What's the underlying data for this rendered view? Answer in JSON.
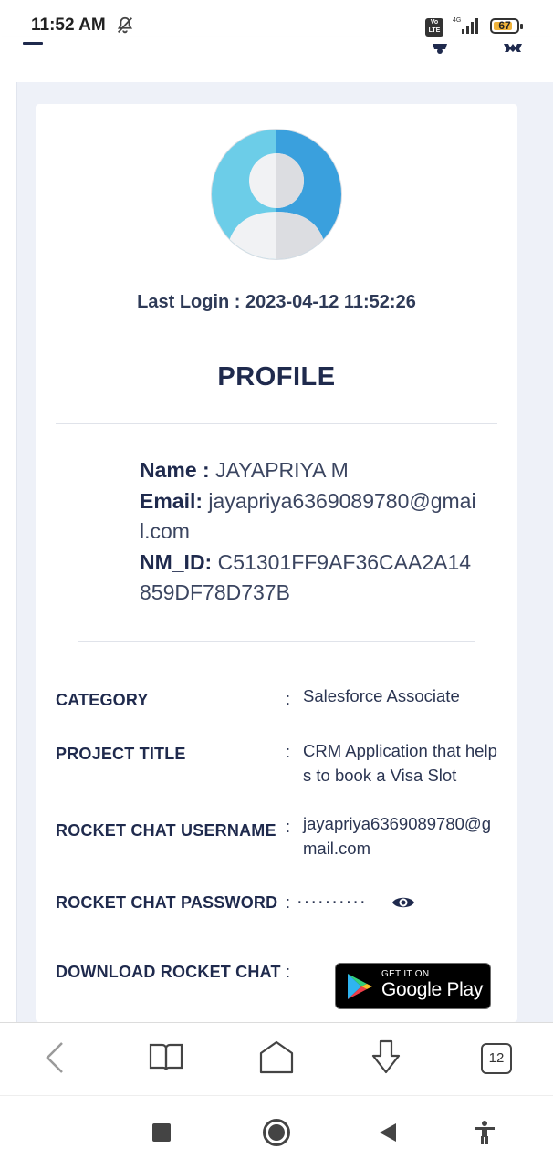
{
  "status_bar": {
    "time": "11:52 AM",
    "network_label": "4G",
    "volte_label": "Vo LTE",
    "battery_level": "67",
    "colors": {
      "battery_fill": "#f0b33a"
    }
  },
  "header": {
    "icons": [
      "menu-icon",
      "bell-icon",
      "gear-icon"
    ]
  },
  "profile": {
    "last_login": "Last Login : 2023-04-12 11:52:26",
    "title": "PROFILE",
    "name_label": "Name : ",
    "name_value": "JAYAPRIYA M",
    "email_label": "Email: ",
    "email_value": "jayapriya6369089780@gmail.com",
    "nm_id_label": "NM_ID: ",
    "nm_id_value": "C51301FF9AF36CAA2A14859DF78D737B"
  },
  "details": {
    "category_label": "CATEGORY",
    "category_value": "Salesforce Associate",
    "project_title_label": "PROJECT TITLE",
    "project_title_value": "CRM Application that helps to book a Visa Slot",
    "rc_username_label": "ROCKET CHAT USERNAME",
    "rc_username_value": "jayapriya6369089780@gmail.com",
    "rc_password_label": "ROCKET CHAT PASSWORD",
    "rc_password_value": "··········",
    "download_label": "DOWNLOAD ROCKET CHAT",
    "colon": ":",
    "google_play_small": "GET IT ON",
    "google_play_big": "Google Play"
  },
  "browser_toolbar": {
    "icons": [
      "back-icon",
      "book-icon",
      "home-icon",
      "download-icon",
      "tabs-icon"
    ],
    "tab_count": "12"
  },
  "system_nav": {
    "icons": [
      "recents-icon",
      "home-circle-icon",
      "back-triangle-icon",
      "accessibility-icon"
    ]
  },
  "colors": {
    "text_primary": "#1f2a4d",
    "page_background": "#eef1f8",
    "avatar_light": "#6ccde8",
    "avatar_dark": "#3aa0dd"
  }
}
